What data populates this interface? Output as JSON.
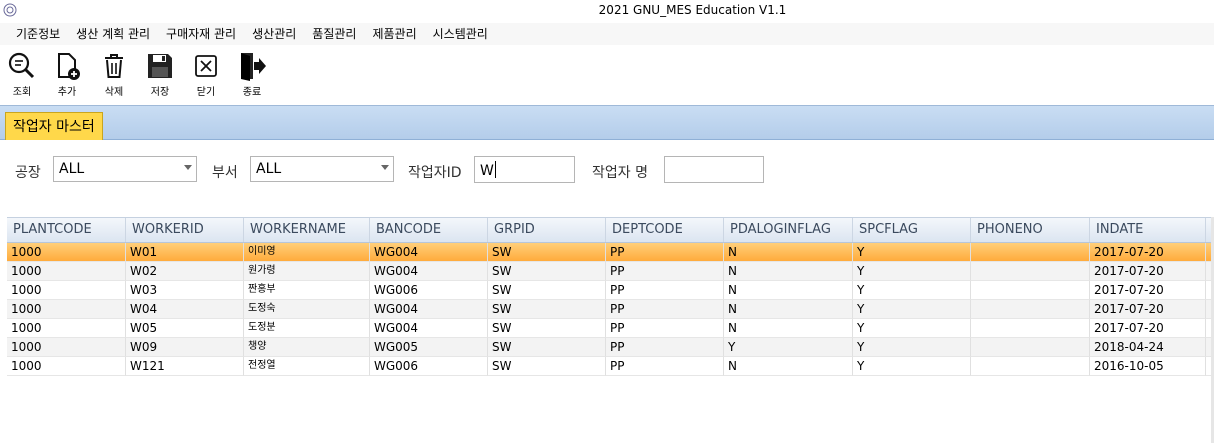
{
  "window": {
    "title": "2021 GNU_MES Education V1.1"
  },
  "menu": [
    "기준정보",
    "생산 계획 관리",
    "구매자재 관리",
    "생산관리",
    "품질관리",
    "제품관리",
    "시스템관리"
  ],
  "toolbar": {
    "search": "조회",
    "add": "추가",
    "delete": "삭제",
    "save": "저장",
    "close": "닫기",
    "exit": "종료"
  },
  "tabs": {
    "active": "작업자 마스터"
  },
  "filters": {
    "plant_label": "공장",
    "plant_value": "ALL",
    "dept_label": "부서",
    "dept_value": "ALL",
    "workerid_label": "작업자ID",
    "workerid_value": "W",
    "workername_label": "작업자 명",
    "workername_value": ""
  },
  "grid": {
    "columns": [
      "PLANTCODE",
      "WORKERID",
      "WORKERNAME",
      "BANCODE",
      "GRPID",
      "DEPTCODE",
      "PDALOGINFLAG",
      "SPCFLAG",
      "PHONENO",
      "INDATE"
    ],
    "rows": [
      [
        "1000",
        "W01",
        "이미영",
        "WG004",
        "SW",
        "PP",
        "N",
        "Y",
        "",
        "2017-07-20"
      ],
      [
        "1000",
        "W02",
        "원가령",
        "WG004",
        "SW",
        "PP",
        "N",
        "Y",
        "",
        "2017-07-20"
      ],
      [
        "1000",
        "W03",
        "짠홍부",
        "WG006",
        "SW",
        "PP",
        "N",
        "Y",
        "",
        "2017-07-20"
      ],
      [
        "1000",
        "W04",
        "도정숙",
        "WG004",
        "SW",
        "PP",
        "N",
        "Y",
        "",
        "2017-07-20"
      ],
      [
        "1000",
        "W05",
        "도정분",
        "WG004",
        "SW",
        "PP",
        "N",
        "Y",
        "",
        "2017-07-20"
      ],
      [
        "1000",
        "W09",
        "챙양",
        "WG005",
        "SW",
        "PP",
        "Y",
        "Y",
        "",
        "2018-04-24"
      ],
      [
        "1000",
        "W121",
        "전정열",
        "WG006",
        "SW",
        "PP",
        "N",
        "Y",
        "",
        "2016-10-05"
      ]
    ],
    "selected_row": 0
  },
  "colors": {
    "tab_active": "#ffd84a",
    "tab_strip": "#c9ddf3",
    "row_selected": "#ffa938",
    "header": "#dbe5f1"
  }
}
